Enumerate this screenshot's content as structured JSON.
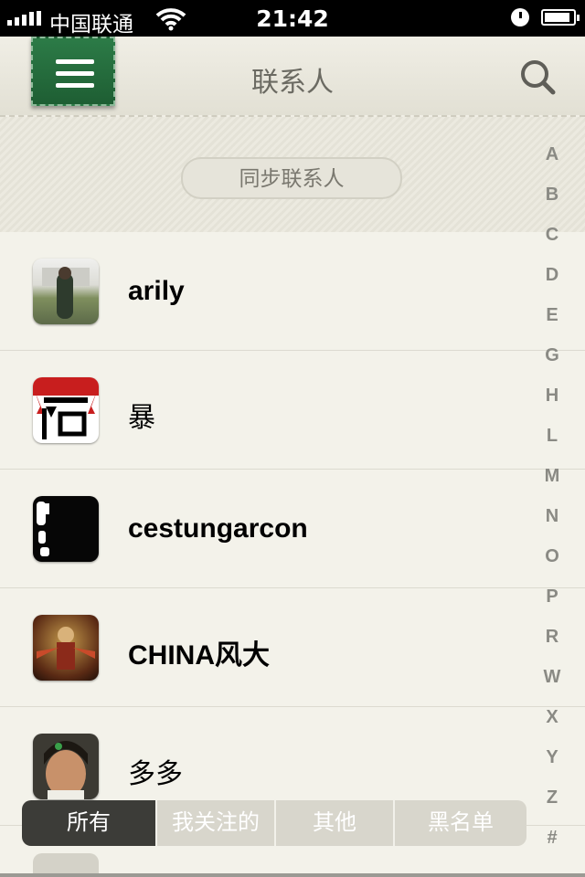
{
  "status_bar": {
    "carrier": "中国联通",
    "time": "21:42"
  },
  "nav": {
    "title": "联系人",
    "menu_icon": "menu-icon",
    "search_icon": "search-icon"
  },
  "sync_button": "同步联系人",
  "contacts": [
    {
      "name": "arily"
    },
    {
      "name": "暴"
    },
    {
      "name": "cestungarcon"
    },
    {
      "name": "CHINA风大"
    },
    {
      "name": "多多"
    }
  ],
  "index_letters": [
    "A",
    "B",
    "C",
    "D",
    "E",
    "G",
    "H",
    "L",
    "M",
    "N",
    "O",
    "P",
    "R",
    "W",
    "X",
    "Y",
    "Z",
    "#"
  ],
  "tabs": [
    {
      "label": "所有",
      "active": true
    },
    {
      "label": "我关注的",
      "active": false
    },
    {
      "label": "其他",
      "active": false
    },
    {
      "label": "黑名单",
      "active": false
    }
  ],
  "colors": {
    "accent_green": "#2c7b47",
    "background": "#f3f2ea",
    "active_tab": "#3c3c38"
  }
}
